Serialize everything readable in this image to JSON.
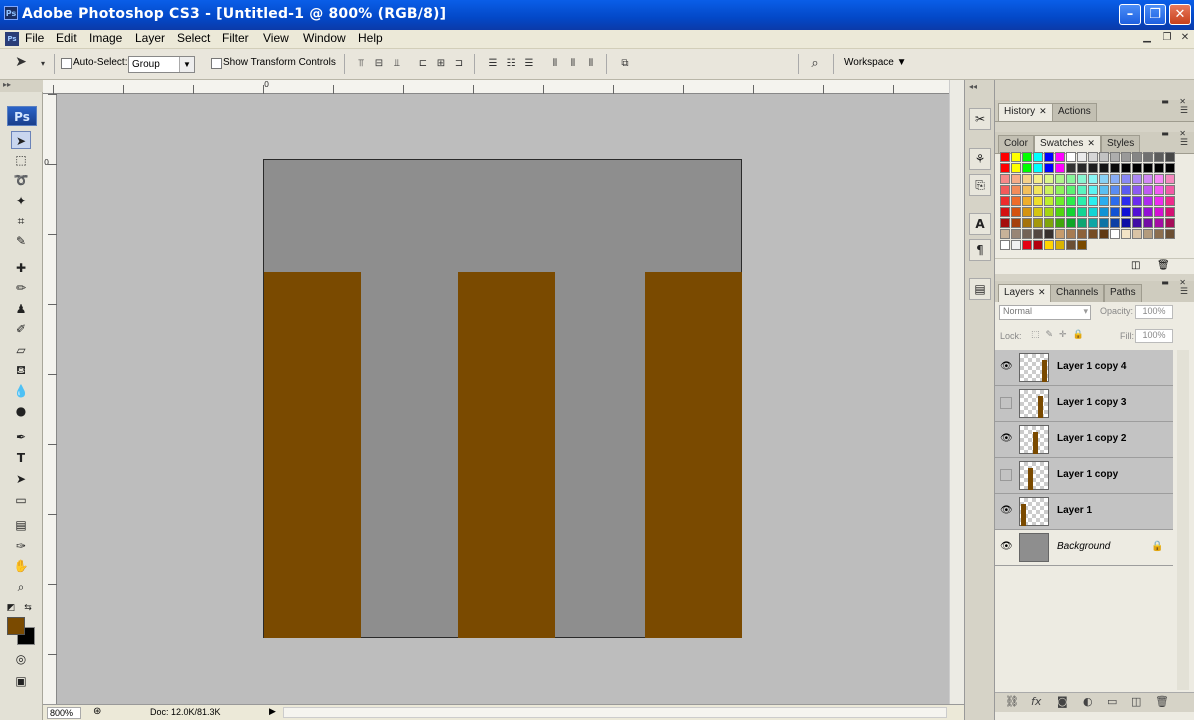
{
  "window": {
    "title": "Adobe Photoshop CS3 - [Untitled-1 @ 800% (RGB/8)]",
    "app_icon": "Ps"
  },
  "menu": [
    "File",
    "Edit",
    "Image",
    "Layer",
    "Select",
    "Filter",
    "View",
    "Window",
    "Help"
  ],
  "options_bar": {
    "auto_select_label": "Auto-Select:",
    "auto_select_value": "Group",
    "transform_label": "Show Transform Controls",
    "workspace_label": "Workspace"
  },
  "toolbox": {
    "logo": "Ps"
  },
  "colors": {
    "foreground": "#7a4a00",
    "background": "#000000",
    "canvas_gray": "#8e8e8e",
    "brown": "#7a4a00"
  },
  "rulers": {
    "top_zero": "0",
    "left_zero": "0"
  },
  "status": {
    "zoom": "800%",
    "doc": "Doc: 12.0K/81.3K"
  },
  "panels": {
    "history_tabs": [
      "History",
      "Actions"
    ],
    "color_tabs": [
      "Color",
      "Swatches",
      "Styles"
    ],
    "layers_tabs": [
      "Layers",
      "Channels",
      "Paths"
    ],
    "blend_mode": "Normal",
    "opacity_label": "Opacity:",
    "opacity_value": "100%",
    "lock_label": "Lock:",
    "fill_label": "Fill:",
    "fill_value": "100%"
  },
  "layers": [
    {
      "name": "Layer 1 copy 4",
      "visible": true
    },
    {
      "name": "Layer 1 copy 3",
      "visible": false
    },
    {
      "name": "Layer 1 copy 2",
      "visible": true
    },
    {
      "name": "Layer 1 copy",
      "visible": false
    },
    {
      "name": "Layer 1",
      "visible": true
    },
    {
      "name": "Background",
      "visible": true,
      "locked": true
    }
  ]
}
